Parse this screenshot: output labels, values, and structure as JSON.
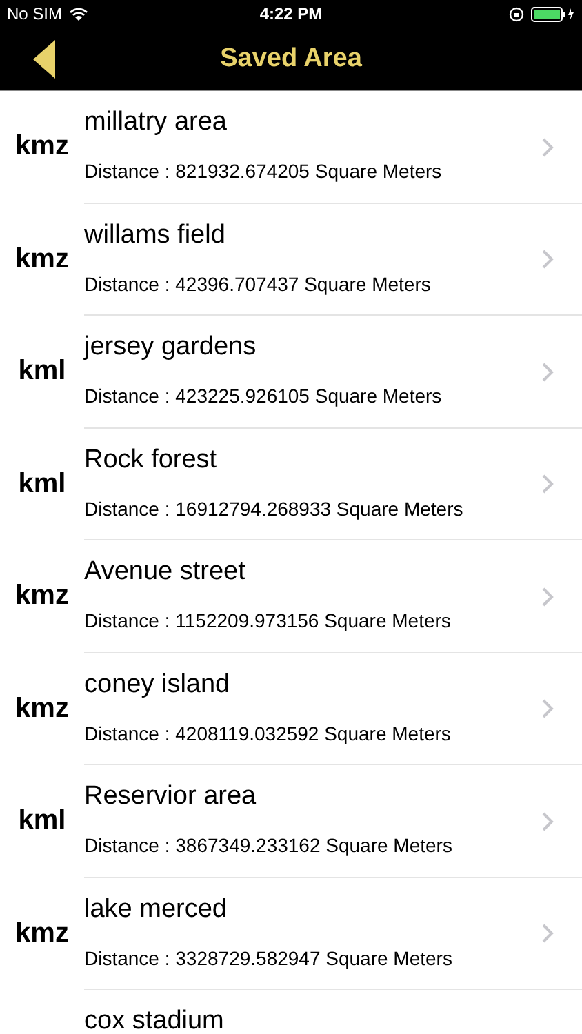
{
  "status_bar": {
    "carrier": "No SIM",
    "time": "4:22 PM"
  },
  "nav": {
    "title": "Saved Area"
  },
  "items": [
    {
      "type": "kmz",
      "name": "millatry area",
      "distance": "Distance : 821932.674205 Square Meters"
    },
    {
      "type": "kmz",
      "name": "willams field",
      "distance": "Distance : 42396.707437 Square Meters"
    },
    {
      "type": "kml",
      "name": "jersey gardens",
      "distance": "Distance : 423225.926105 Square Meters"
    },
    {
      "type": "kml",
      "name": "Rock forest",
      "distance": "Distance : 16912794.268933 Square Meters"
    },
    {
      "type": "kmz",
      "name": "Avenue street",
      "distance": "Distance : 1152209.973156 Square Meters"
    },
    {
      "type": "kmz",
      "name": "coney island",
      "distance": "Distance : 4208119.032592 Square Meters"
    },
    {
      "type": "kml",
      "name": "Reservior area",
      "distance": "Distance : 3867349.233162 Square Meters"
    },
    {
      "type": "kmz",
      "name": "lake merced",
      "distance": "Distance : 3328729.582947 Square Meters"
    },
    {
      "name": "cox stadium"
    }
  ]
}
